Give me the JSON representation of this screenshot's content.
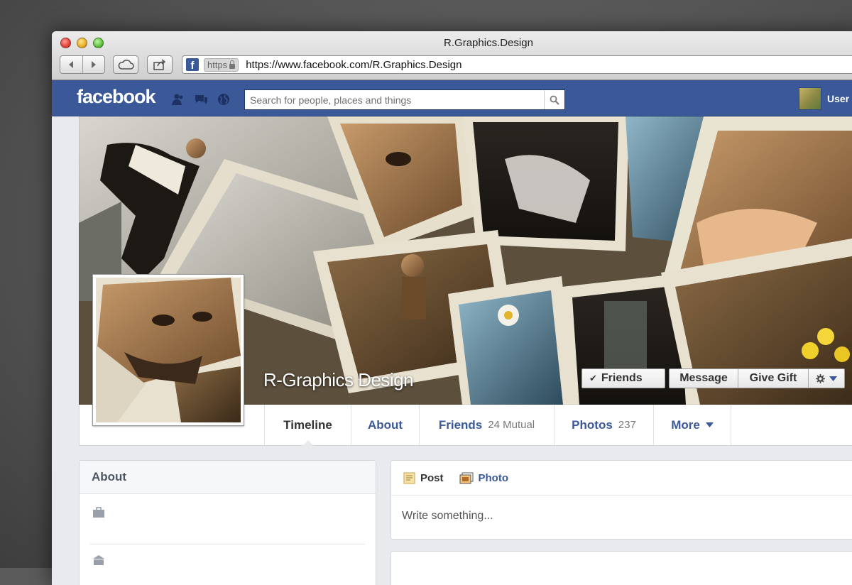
{
  "window": {
    "title": "R.Graphics.Design"
  },
  "browser": {
    "scheme_badge": "https",
    "url": "https://www.facebook.com/R.Graphics.Design",
    "favicon_letter": "f"
  },
  "facebook_bar": {
    "logo": "facebook",
    "search_placeholder": "Search for people, places and things",
    "user_name": "User"
  },
  "profile": {
    "name": "R-Graphics Design",
    "friends_button": "Friends",
    "message_button": "Message",
    "give_gift_button": "Give Gift"
  },
  "tabs": [
    {
      "label": "Timeline",
      "count": ""
    },
    {
      "label": "About",
      "count": ""
    },
    {
      "label": "Friends",
      "count": "24 Mutual"
    },
    {
      "label": "Photos",
      "count": "237"
    },
    {
      "label": "More",
      "count": ""
    }
  ],
  "about_box": {
    "title": "About"
  },
  "composer": {
    "post_label": "Post",
    "photo_label": "Photo",
    "placeholder": "Write something..."
  },
  "colors": {
    "facebook_blue": "#3b5998",
    "link": "#3b5998",
    "page_bg": "#e9eaed"
  }
}
